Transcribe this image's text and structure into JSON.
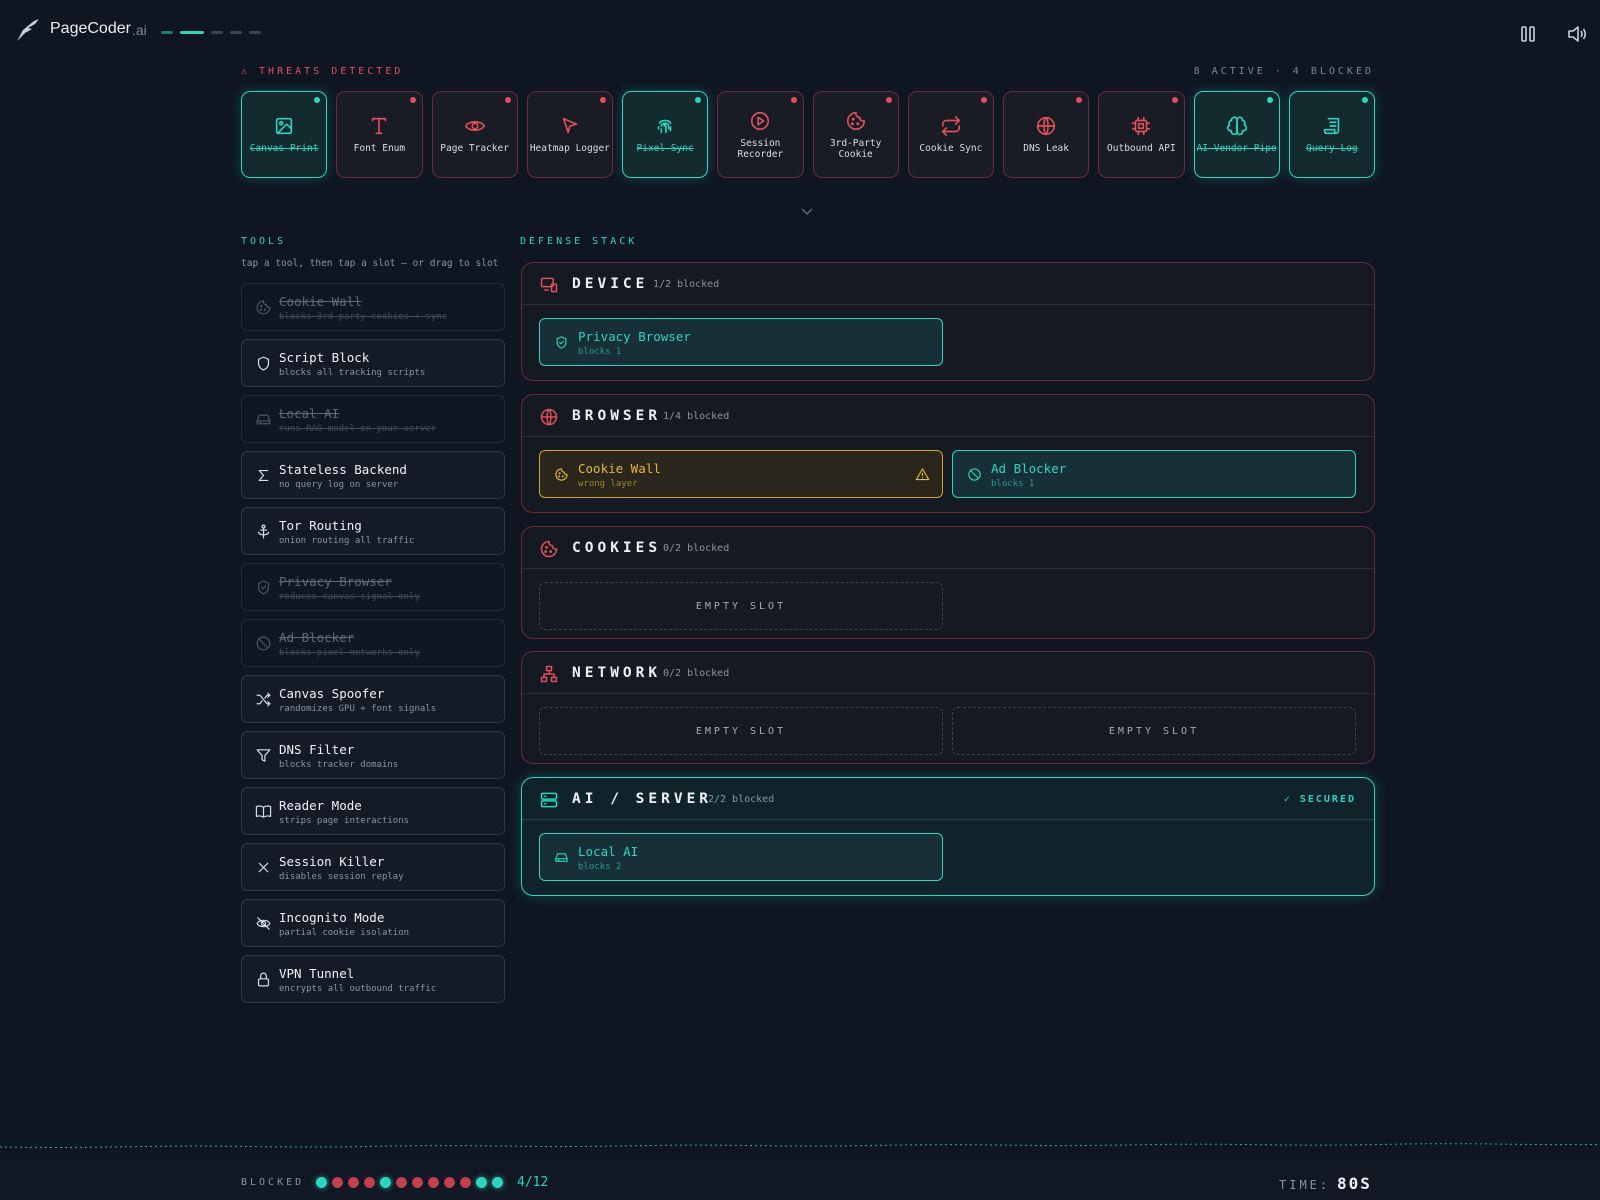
{
  "header": {
    "brand": "PageCoder",
    "brand_suffix": ".ai",
    "progress": {
      "current_step": 2,
      "total_steps": 5
    }
  },
  "threats": {
    "title": "⚠ THREATS DETECTED",
    "status": "8 ACTIVE · 4 BLOCKED",
    "items": [
      {
        "label": "Canvas Print",
        "icon": "image-icon",
        "blocked": true
      },
      {
        "label": "Font Enum",
        "icon": "type-icon",
        "blocked": false
      },
      {
        "label": "Page Tracker",
        "icon": "eye-icon",
        "blocked": false
      },
      {
        "label": "Heatmap Logger",
        "icon": "cursor-icon",
        "blocked": false
      },
      {
        "label": "Pixel Sync",
        "icon": "fingerprint-icon",
        "blocked": true
      },
      {
        "label": "Session Recorder",
        "icon": "play-circle-icon",
        "blocked": false
      },
      {
        "label": "3rd-Party Cookie",
        "icon": "cookie-icon",
        "blocked": false
      },
      {
        "label": "Cookie Sync",
        "icon": "repeat-icon",
        "blocked": false
      },
      {
        "label": "DNS Leak",
        "icon": "globe-icon",
        "blocked": false
      },
      {
        "label": "Outbound API",
        "icon": "chip-icon",
        "blocked": false
      },
      {
        "label": "AI Vendor Pipe",
        "icon": "brain-icon",
        "blocked": true
      },
      {
        "label": "Query Log",
        "icon": "scroll-icon",
        "blocked": true
      }
    ]
  },
  "tools": {
    "title": "TOOLS",
    "hint": "tap a tool, then tap a slot — or drag to slot",
    "items": [
      {
        "name": "Cookie Wall",
        "desc": "blocks 3rd-party cookies + sync",
        "icon": "cookie-icon",
        "used": true
      },
      {
        "name": "Script Block",
        "desc": "blocks all tracking scripts",
        "icon": "shield-icon",
        "used": false
      },
      {
        "name": "Local AI",
        "desc": "runs RAG model on your server",
        "icon": "drive-icon",
        "used": true
      },
      {
        "name": "Stateless Backend",
        "desc": "no query log on server",
        "icon": "sigma-icon",
        "used": false
      },
      {
        "name": "Tor Routing",
        "desc": "onion routing all traffic",
        "icon": "anchor-icon",
        "used": false
      },
      {
        "name": "Privacy Browser",
        "desc": "reduces canvas signal only",
        "icon": "shield-check-icon",
        "used": true
      },
      {
        "name": "Ad Blocker",
        "desc": "blocks pixel networks only",
        "icon": "ban-icon",
        "used": true
      },
      {
        "name": "Canvas Spoofer",
        "desc": "randomizes GPU + font signals",
        "icon": "shuffle-icon",
        "used": false
      },
      {
        "name": "DNS Filter",
        "desc": "blocks tracker domains",
        "icon": "filter-icon",
        "used": false
      },
      {
        "name": "Reader Mode",
        "desc": "strips page interactions",
        "icon": "book-icon",
        "used": false
      },
      {
        "name": "Session Killer",
        "desc": "disables session replay",
        "icon": "x-icon",
        "used": false
      },
      {
        "name": "Incognito Mode",
        "desc": "partial cookie isolation",
        "icon": "eye-off-icon",
        "used": false
      },
      {
        "name": "VPN Tunnel",
        "desc": "encrypts all outbound traffic",
        "icon": "lock-icon",
        "used": false
      }
    ]
  },
  "stack": {
    "title": "DEFENSE STACK",
    "empty_label": "EMPTY SLOT",
    "layers": [
      {
        "name": "DEVICE",
        "count": "1/2 blocked",
        "icon": "devices-icon",
        "secured": false,
        "slots": [
          {
            "state": "filled",
            "name": "Privacy Browser",
            "desc": "blocks 1",
            "icon": "shield-check-icon"
          }
        ]
      },
      {
        "name": "BROWSER",
        "count": "1/4 blocked",
        "icon": "globe-icon",
        "secured": false,
        "slots": [
          {
            "state": "warn",
            "name": "Cookie Wall",
            "desc": "wrong layer",
            "icon": "cookie-icon"
          },
          {
            "state": "filled",
            "name": "Ad Blocker",
            "desc": "blocks 1",
            "icon": "ban-icon"
          }
        ]
      },
      {
        "name": "COOKIES",
        "count": "0/2 blocked",
        "icon": "cookie-icon",
        "secured": false,
        "slots": [
          {
            "state": "empty"
          }
        ]
      },
      {
        "name": "NETWORK",
        "count": "0/2 blocked",
        "icon": "network-icon",
        "secured": false,
        "slots": [
          {
            "state": "empty"
          },
          {
            "state": "empty"
          }
        ]
      },
      {
        "name": "AI / SERVER",
        "count": "2/2 blocked",
        "icon": "server-icon",
        "secured": true,
        "secured_label": "✓ SECURED",
        "slots": [
          {
            "state": "filled",
            "name": "Local AI",
            "desc": "blocks 2",
            "icon": "drive-icon"
          }
        ]
      }
    ]
  },
  "footer": {
    "blocked_label": "BLOCKED",
    "blocked_count": "4/12",
    "blocked_flags": [
      true,
      false,
      false,
      false,
      true,
      false,
      false,
      false,
      false,
      false,
      true,
      true
    ],
    "time_label": "TIME:",
    "time_value": "80S"
  },
  "colors": {
    "accent": "#2dd4bf",
    "danger": "#e0505a",
    "warning": "#e8b63a",
    "background": "#0f1622"
  }
}
